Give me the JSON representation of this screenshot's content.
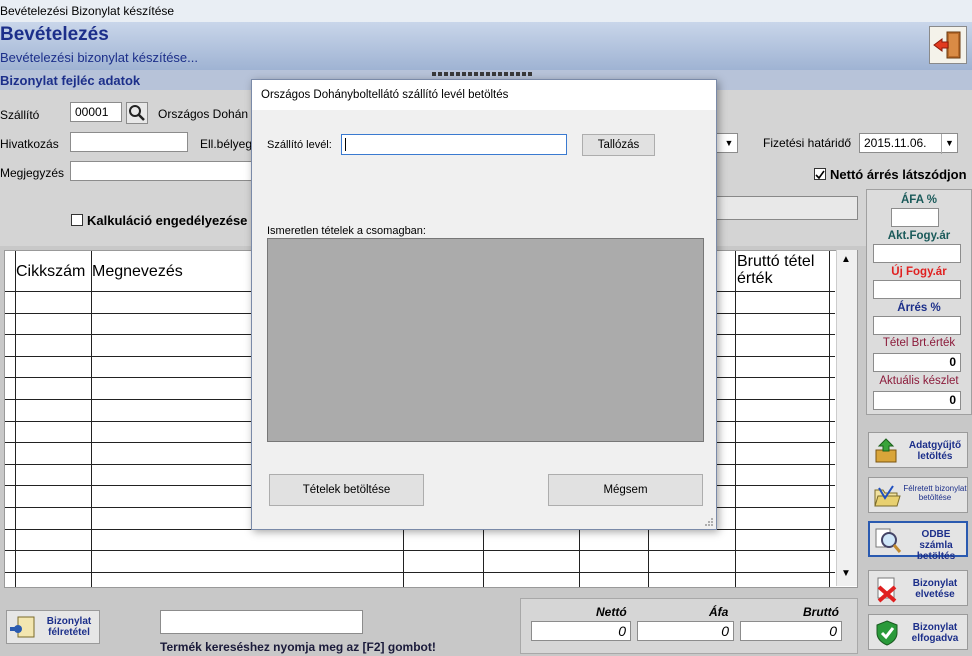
{
  "window": {
    "title": "Bevételezési Bizonylat készítése"
  },
  "banner": {
    "title": "Bevételezés",
    "subtitle": "Bevételezési bizonylat készítése...",
    "exit_icon": "exit-door-icon"
  },
  "section": {
    "title": "Bizonylat fejléc adatok"
  },
  "header": {
    "szallito_label": "Szállító",
    "szallito_code": "00001",
    "szallito_name": "Országos Dohán",
    "hivatkozas_label": "Hivatkozás",
    "ellbelyeg_label": "Ell.bélyeg",
    "megjegyzes_label": "Megjegyzés",
    "fizetesi_label": "Fizetési határidő",
    "fizetesi_value": "2015.11.06.",
    "netto_arres_label": "Nettó árrés látszódjon",
    "kalkulacio_label": "Kalkuláció engedélyezése"
  },
  "grid": {
    "columns": [
      "Cikkszám",
      "Megnevezés",
      "Bruttó tétel érték"
    ]
  },
  "right_panel": {
    "afa_label": "ÁFA %",
    "akt_fogy_label": "Akt.Fogy.ár",
    "uj_fogy_label": "Új Fogy.ár",
    "arres_label": "Árrés %",
    "tetel_brt_label": "Tétel Brt.érték",
    "tetel_brt_value": "0",
    "aktualis_label": "Aktuális készlet",
    "aktualis_value": "0",
    "colors": {
      "navy": "#1c2f8a",
      "red": "#e02020",
      "darkred": "#8b1a3a",
      "teal": "#1a5a5a"
    }
  },
  "side_buttons": {
    "adatgyujto": "Adatgyűjtő letöltés",
    "felretett": "Félretett bizonylat betöltése",
    "odbe": "ODBE számla betöltés",
    "elvetese": "Bizonylat elvetése",
    "elfogadva": "Bizonylat elfogadva"
  },
  "bottom": {
    "felretetel_button": "Bizonylat félretétel",
    "hint": "Termék kereséshez nyomja meg az [F2] gombot!",
    "netto_label": "Nettó",
    "afa_label": "Áfa",
    "brutto_label": "Bruttó",
    "netto_value": "0",
    "afa_value": "0",
    "brutto_value": "0"
  },
  "modal": {
    "title": "Országos Dohányboltellátó szállító levél betöltés",
    "szallito_level_label": "Szállító levél:",
    "szallito_level_value": "",
    "browse_button": "Tallózás",
    "unknown_items_label": "Ismeretlen tételek a csomagban:",
    "load_button": "Tételek betöltése",
    "cancel_button": "Mégsem"
  }
}
